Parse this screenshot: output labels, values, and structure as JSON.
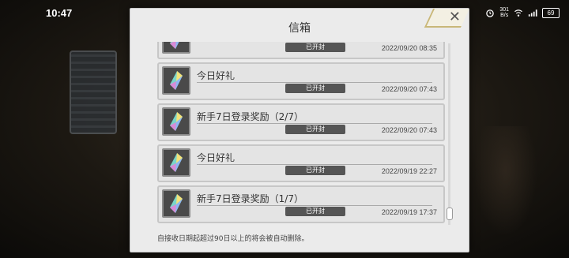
{
  "status_bar": {
    "time": "10:47",
    "net_speed": "301",
    "net_unit": "B/s",
    "battery": "69",
    "icons": [
      "alarm-icon",
      "wifi-icon",
      "signal-icon",
      "battery-icon"
    ]
  },
  "mailbox": {
    "title": "信箱",
    "close_label": "✕",
    "items": [
      {
        "title": "",
        "status": "已开封",
        "date": "2022/09/20 08:35"
      },
      {
        "title": "今日好礼",
        "status": "已开封",
        "date": "2022/09/20 07:43"
      },
      {
        "title": "新手7日登录奖励（2/7）",
        "status": "已开封",
        "date": "2022/09/20 07:43"
      },
      {
        "title": "今日好礼",
        "status": "已开封",
        "date": "2022/09/19 22:27"
      },
      {
        "title": "新手7日登录奖励（1/7）",
        "status": "已开封",
        "date": "2022/09/19 17:37"
      }
    ],
    "footer_note": "自接收日期起超过90日以上的将会被自动删除。"
  }
}
